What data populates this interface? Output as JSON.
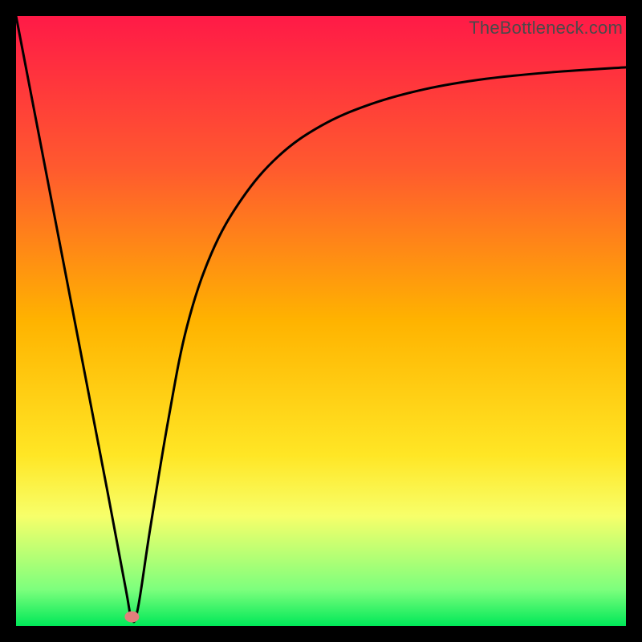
{
  "watermark": "TheBottleneck.com",
  "chart_data": {
    "type": "line",
    "title": "",
    "xlabel": "",
    "ylabel": "",
    "xlim": [
      0,
      100
    ],
    "ylim": [
      0,
      100
    ],
    "legend": false,
    "grid": false,
    "background_gradient": {
      "stops": [
        {
          "offset": 0.0,
          "color": "#ff1a47"
        },
        {
          "offset": 0.25,
          "color": "#ff5a2e"
        },
        {
          "offset": 0.5,
          "color": "#ffb300"
        },
        {
          "offset": 0.72,
          "color": "#ffe625"
        },
        {
          "offset": 0.82,
          "color": "#f7ff6a"
        },
        {
          "offset": 0.94,
          "color": "#7dff7d"
        },
        {
          "offset": 1.0,
          "color": "#00e858"
        }
      ]
    },
    "marker": {
      "x": 19,
      "y": 1.5,
      "color": "#e37f7c"
    },
    "series": [
      {
        "name": "curve",
        "color": "#000000",
        "x": [
          0,
          5,
          10,
          15,
          18,
          19,
          20,
          22,
          25,
          28,
          32,
          37,
          43,
          50,
          58,
          67,
          77,
          88,
          100
        ],
        "y": [
          100,
          74,
          48,
          22,
          6,
          1,
          3,
          16,
          34,
          49,
          61,
          70,
          77,
          82,
          85.5,
          88,
          89.7,
          90.8,
          91.6
        ]
      }
    ]
  }
}
